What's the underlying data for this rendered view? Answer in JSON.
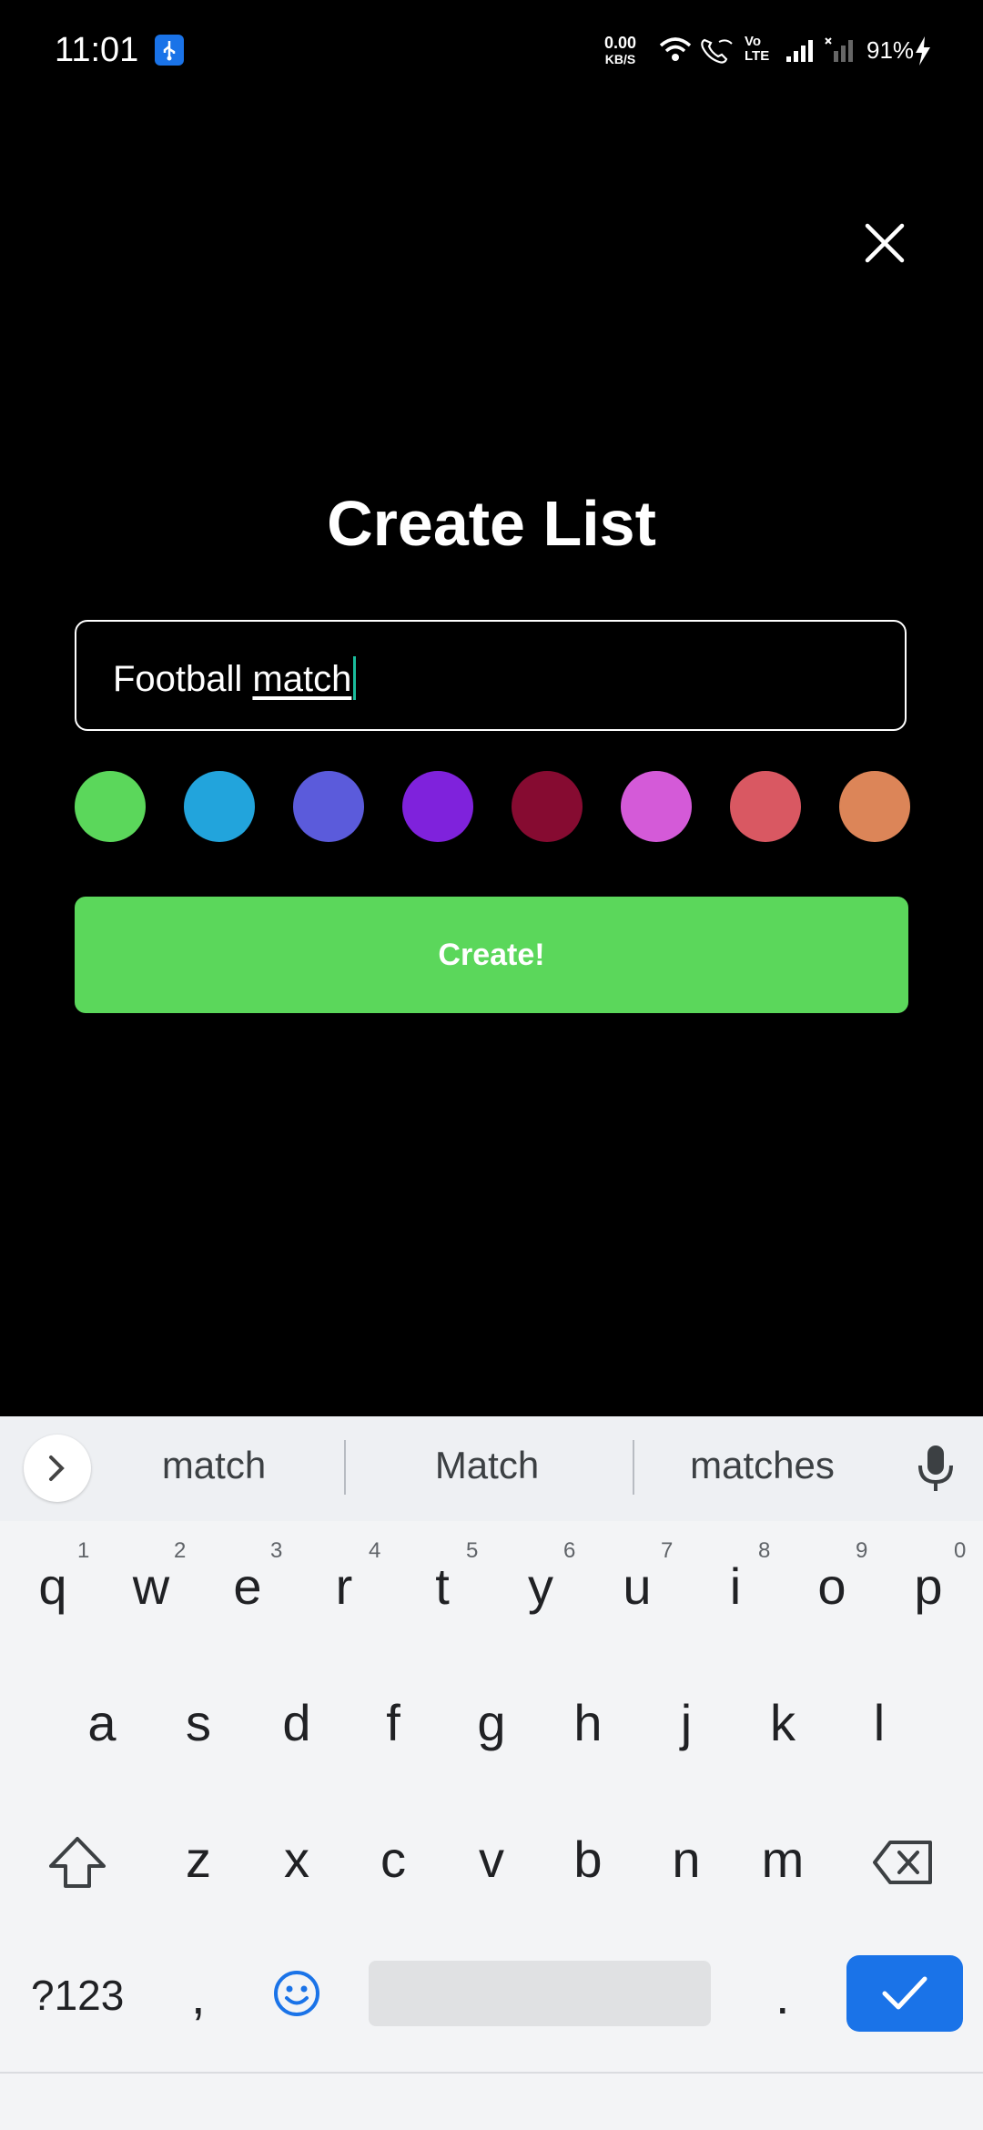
{
  "status_bar": {
    "time": "11:01",
    "net_speed_value": "0.00",
    "net_speed_unit": "KB/S",
    "volte": "Vo LTE",
    "battery": "91%"
  },
  "dialog": {
    "title": "Create List",
    "input_value_prefix": "Football ",
    "input_value_composing": "match",
    "colors": [
      "#5bd75b",
      "#22a4dc",
      "#5b5bdb",
      "#7f22dc",
      "#860b31",
      "#d45ad8",
      "#d95862",
      "#dc8558"
    ],
    "create_label": "Create!"
  },
  "keyboard": {
    "suggestions": [
      "match",
      "Match",
      "matches"
    ],
    "row1": [
      "q",
      "w",
      "e",
      "r",
      "t",
      "y",
      "u",
      "i",
      "o",
      "p"
    ],
    "row1_numbers": [
      "1",
      "2",
      "3",
      "4",
      "5",
      "6",
      "7",
      "8",
      "9",
      "0"
    ],
    "row2": [
      "a",
      "s",
      "d",
      "f",
      "g",
      "h",
      "j",
      "k",
      "l"
    ],
    "row3": [
      "z",
      "x",
      "c",
      "v",
      "b",
      "n",
      "m"
    ],
    "symbols_label": "?123",
    "comma": ",",
    "period": "."
  }
}
